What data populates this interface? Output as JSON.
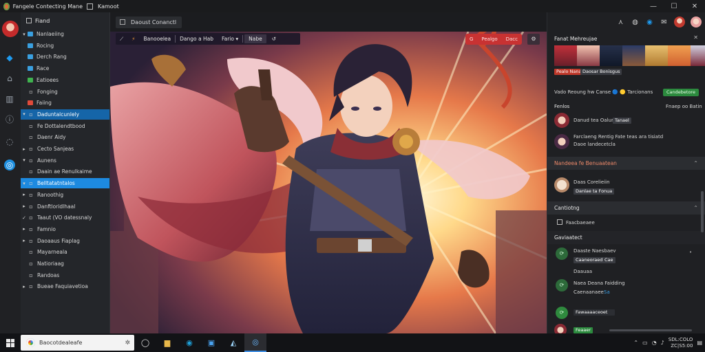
{
  "window": {
    "app_name": "Fangele Contecting Mane",
    "tab_label": "Kamoot"
  },
  "breadcrumb": {
    "label": "Daoust Conanctl"
  },
  "tree": {
    "header": "Fiand",
    "items": [
      {
        "label": "Nanlaeiing",
        "arrow": "▾",
        "color": "#3aa0e0"
      },
      {
        "label": "Rocing",
        "arrow": "",
        "color": "#3aa0e0"
      },
      {
        "label": "Derch Rang",
        "arrow": "",
        "color": "#3aa0e0"
      },
      {
        "label": "Race",
        "arrow": "",
        "color": "#3aa0e0"
      },
      {
        "label": "Eatioees",
        "arrow": "",
        "color": "#3fb34f"
      },
      {
        "label": "Fonging",
        "arrow": "",
        "color": ""
      },
      {
        "label": "Faiing",
        "arrow": "",
        "color": "#e04a3a"
      },
      {
        "label": "Daduntalcunlely",
        "arrow": "▾",
        "color": "",
        "selected": true
      },
      {
        "label": "Fe Dottalendtbood",
        "arrow": "",
        "color": ""
      },
      {
        "label": "Daenr Aidy",
        "arrow": "",
        "color": ""
      },
      {
        "label": "Cecto Sanjeas",
        "arrow": "▸",
        "color": ""
      },
      {
        "label": "Aunens",
        "arrow": "▾",
        "color": ""
      },
      {
        "label": "Daain ae Renulkaime",
        "arrow": "",
        "color": ""
      },
      {
        "label": "Belltatatntalos",
        "arrow": "▾",
        "color": "",
        "selected_bright": true
      },
      {
        "label": "Ranoothig",
        "arrow": "▸",
        "color": ""
      },
      {
        "label": "Danftloridlhaal",
        "arrow": "▸",
        "color": ""
      },
      {
        "label": "Taaut (VO datessnaly",
        "arrow": "✓",
        "color": ""
      },
      {
        "label": "Famnio",
        "arrow": "▸",
        "color": ""
      },
      {
        "label": "Daoaaus Fiaplag",
        "arrow": "▸",
        "color": ""
      },
      {
        "label": "Mayarneala",
        "arrow": "",
        "color": ""
      },
      {
        "label": "Natioriaag",
        "arrow": "",
        "color": ""
      },
      {
        "label": "Randoas",
        "arrow": "",
        "color": ""
      },
      {
        "label": "Bueae Faquiavetioa",
        "arrow": "▸",
        "color": ""
      }
    ]
  },
  "toolbar": {
    "items": [
      "Banooelea",
      "Dango a Hab",
      "Fario",
      "Nabe"
    ]
  },
  "rec": {
    "items": [
      "G",
      "Pealgo",
      "Dacc"
    ]
  },
  "rpanel": {
    "header": "Fanat Mehreujae",
    "tag_red": "Pealo Nanang",
    "tag_dark": "Daosar Bonisgus",
    "status_line": "Vado Reoung hw Canse 🔵 🟡 Tarcionans",
    "status_btn": "Candebetore",
    "section2_title": "Fenlos",
    "section2_right": "Fnaep oo Batin",
    "row1_name": "Danud tea Oalumg",
    "row1_tag": "Tanael",
    "row2_text": "Farclaeng Rentig Fate teas ara tisiatd",
    "row2_sub": "Daoe landecetcla",
    "bar1_title": "Nandeea fe Benuaatean",
    "row3_name": "Daas Corelieiin",
    "row3_tag": "Danlae ta Fonua",
    "bar2_title": "Cantiotng",
    "row4_label": "Faacbaeaee",
    "bar3_title": "Gaviaatect",
    "c1_name": "Daaste Naesbaev",
    "c1_sub1": "Caaneoraed",
    "c1_sub2": "Cae",
    "c2_label": "Daauaa",
    "c3_name": "Naea Deana Faidding",
    "c3_sub1": "Caenaanaee",
    "c3_sub2": "Sa",
    "c4_label": "Fawaaaaceoet",
    "c5_label": "Feaaer"
  },
  "taskbar": {
    "search_text": "Baocotdealeafe",
    "time": "SDL:COLO",
    "date": "ZC|S5:00"
  }
}
